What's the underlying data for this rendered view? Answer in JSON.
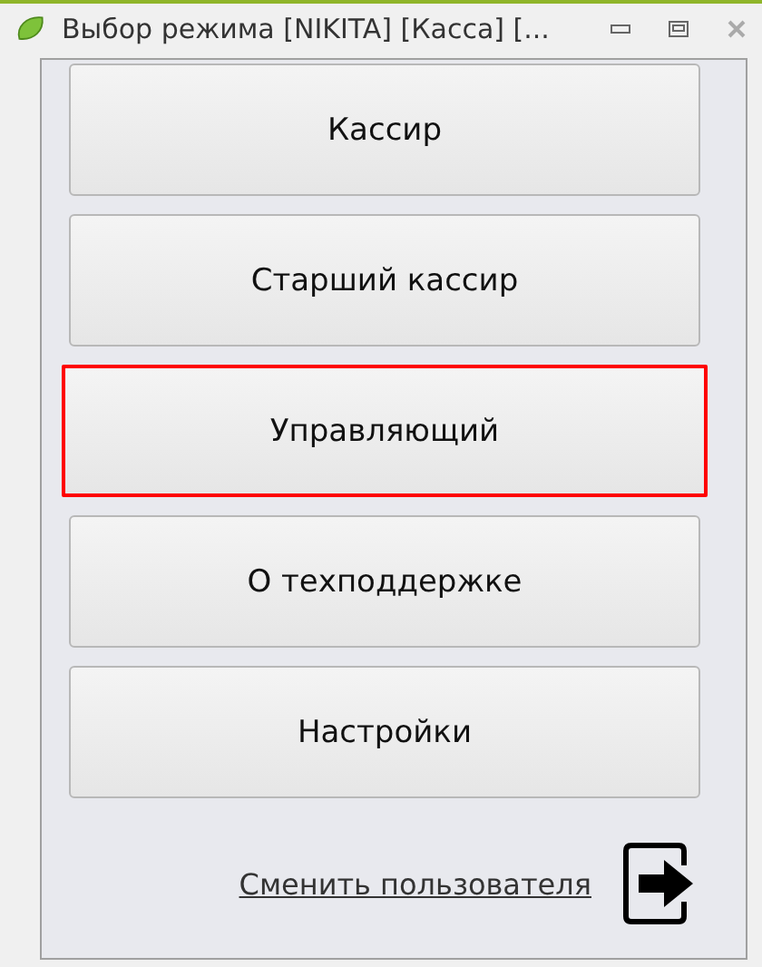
{
  "window": {
    "title": "Выбор режима [NIKITA] [Касса] [..."
  },
  "buttons": [
    {
      "label": "Кассир",
      "selected": false
    },
    {
      "label": "Старший кассир",
      "selected": false
    },
    {
      "label": "Управляющий",
      "selected": true
    },
    {
      "label": "О техподдержке",
      "selected": false
    },
    {
      "label": "Настройки",
      "selected": false
    }
  ],
  "footer": {
    "link": "Сменить пользователя"
  }
}
